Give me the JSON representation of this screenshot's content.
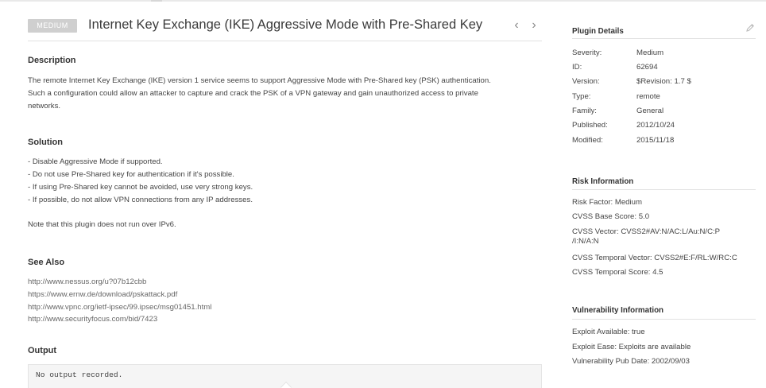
{
  "header": {
    "severity_badge": "MEDIUM",
    "title": "Internet Key Exchange (IKE) Aggressive Mode with Pre-Shared Key",
    "prev_glyph": "‹",
    "next_glyph": "›"
  },
  "description": {
    "heading": "Description",
    "lines": [
      "The remote Internet Key Exchange (IKE) version 1 service seems to support Aggressive Mode with Pre-Shared key (PSK) authentication.",
      "Such a configuration could allow an attacker to capture and crack the PSK of a VPN gateway and gain unauthorized access to private",
      "networks."
    ]
  },
  "solution": {
    "heading": "Solution",
    "lines": [
      "- Disable Aggressive Mode if supported.",
      "- Do not use Pre-Shared key for authentication if it's possible.",
      "- If using Pre-Shared key cannot be avoided, use very strong keys.",
      "- If possible, do not allow VPN connections from any IP addresses."
    ],
    "note": "Note that this plugin does not run over IPv6."
  },
  "see_also": {
    "heading": "See Also",
    "links": [
      "http://www.nessus.org/u?07b12cbb",
      "https://www.ernw.de/download/pskattack.pdf",
      "http://www.vpnc.org/ietf-ipsec/99.ipsec/msg01451.html",
      "http://www.securityfocus.com/bid/7423"
    ]
  },
  "output": {
    "heading": "Output",
    "text": "No output recorded."
  },
  "plugin_details": {
    "heading": "Plugin Details",
    "rows": [
      {
        "label": "Severity:",
        "value": "Medium"
      },
      {
        "label": "ID:",
        "value": "62694"
      },
      {
        "label": "Version:",
        "value": "$Revision: 1.7 $"
      },
      {
        "label": "Type:",
        "value": "remote"
      },
      {
        "label": "Family:",
        "value": "General"
      },
      {
        "label": "Published:",
        "value": "2012/10/24"
      },
      {
        "label": "Modified:",
        "value": "2015/11/18"
      }
    ]
  },
  "risk_information": {
    "heading": "Risk Information",
    "risk_factor": "Risk Factor:  Medium",
    "cvss_base_score": "CVSS Base Score:  5.0",
    "cvss_vector_line1": "CVSS Vector:  CVSS2#AV:N/AC:L/Au:N/C:P",
    "cvss_vector_line2": "/I:N/A:N",
    "cvss_temporal_vector": "CVSS Temporal Vector:  CVSS2#E:F/RL:W/RC:C",
    "cvss_temporal_score": "CVSS Temporal Score:  4.5"
  },
  "vulnerability_information": {
    "heading": "Vulnerability Information",
    "exploit_available": "Exploit Available:  true",
    "exploit_ease": "Exploit Ease:  Exploits are available",
    "pub_date": "Vulnerability Pub Date:  2002/09/03"
  },
  "icons": {
    "edit": "pencil-icon",
    "prev": "chevron-left-icon",
    "next": "chevron-right-icon"
  },
  "colors": {
    "badge_bg": "#cfcfcf",
    "divider": "#e2e2e2",
    "output_bg": "#f5f5f5"
  }
}
